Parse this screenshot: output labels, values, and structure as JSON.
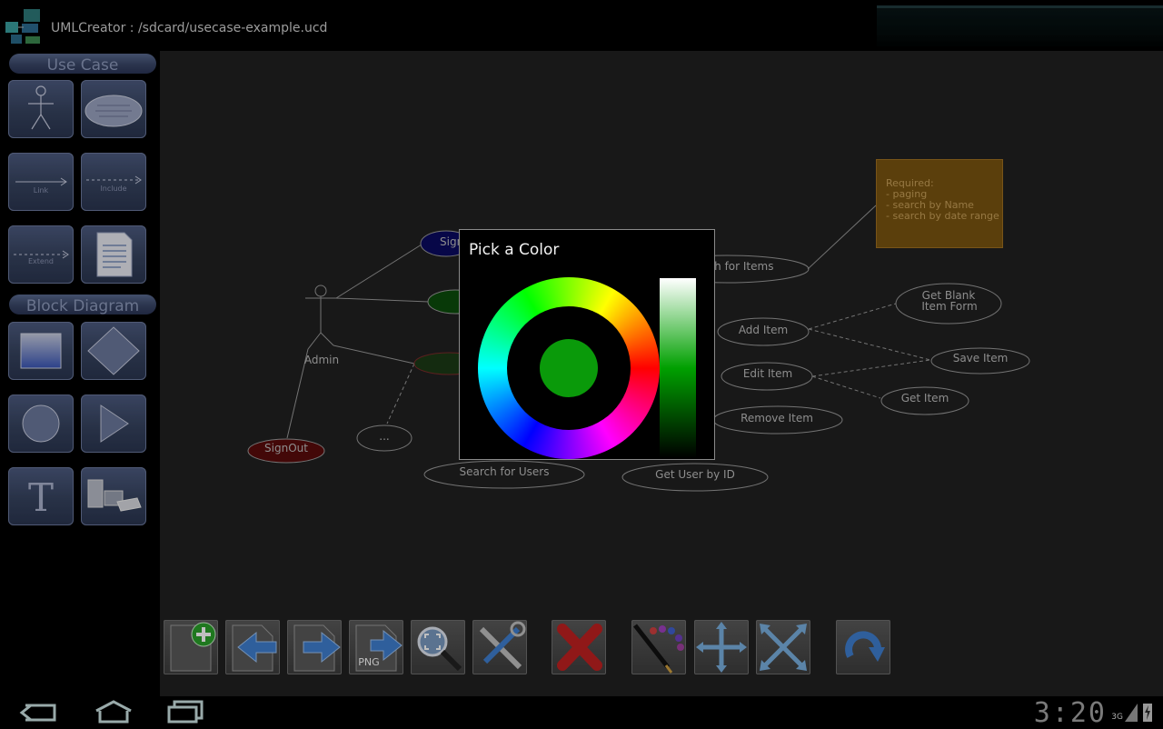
{
  "app": {
    "title": "UMLCreator : /sdcard/usecase-example.ucd"
  },
  "palette": {
    "sections": [
      {
        "label": "Use Case"
      },
      {
        "label": "Block Diagram"
      }
    ],
    "tools": {
      "actor": "actor",
      "usecase": "use case",
      "link_label": "Link",
      "include_label": "Include",
      "extend_label": "Extend",
      "note": "note",
      "rectangle": "rectangle",
      "diamond": "diamond",
      "circle": "circle",
      "triangle": "triangle",
      "text_glyph": "T",
      "component": "component"
    }
  },
  "diagram": {
    "actor_label": "Admin",
    "usecases": {
      "sign_in": "Sign",
      "signout": "SignOut",
      "ellipsis": "...",
      "search_items": "Search for Items",
      "add_item": "Add Item",
      "edit_item": "Edit Item",
      "remove_item": "Remove Item",
      "search_users": "Search for Users",
      "get_user": "Get User by ID",
      "get_blank_1": "Get Blank",
      "get_blank_2": "Item Form",
      "save_item": "Save Item",
      "get_item": "Get Item"
    },
    "note": {
      "lines": [
        "Required:",
        "- paging",
        "- search by Name",
        "- search by date range"
      ],
      "color": "#7a5410"
    }
  },
  "toolbar": {
    "png_label": "PNG",
    "buttons": [
      "new",
      "undo",
      "redo",
      "export png",
      "zoom fit",
      "settings",
      "delete",
      "color",
      "move",
      "expand",
      "refresh"
    ]
  },
  "dialog": {
    "title": "Pick a Color",
    "selected_color": "#0a9a0a"
  },
  "system": {
    "clock": "3:20",
    "network": "3G"
  }
}
